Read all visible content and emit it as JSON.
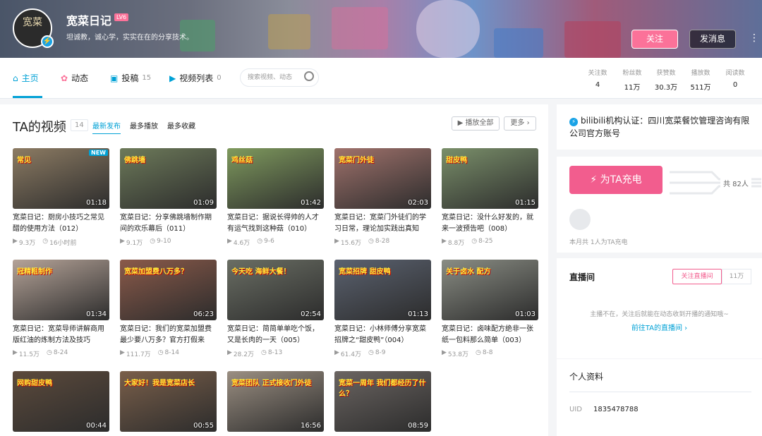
{
  "header": {
    "avatar_text": "宽菜",
    "name": "宽菜日记",
    "level": "LV6",
    "signature": "坦诚教，诚心学，实实在在的分享技术。",
    "follow_label": "关注",
    "message_label": "发消息"
  },
  "nav": {
    "tabs": [
      {
        "label": "主页",
        "count": ""
      },
      {
        "label": "动态",
        "count": ""
      },
      {
        "label": "投稿",
        "count": "15"
      },
      {
        "label": "视频列表",
        "count": "0"
      }
    ],
    "search_placeholder": "搜索视频、动态",
    "stats": [
      {
        "label": "关注数",
        "value": "4"
      },
      {
        "label": "粉丝数",
        "value": "11万"
      },
      {
        "label": "获赞数",
        "value": "30.3万"
      },
      {
        "label": "播放数",
        "value": "511万"
      },
      {
        "label": "阅读数",
        "value": "0"
      }
    ]
  },
  "videos_section": {
    "title": "TA的视频",
    "count": "14",
    "sorts": [
      "最新发布",
      "最多播放",
      "最多收藏"
    ],
    "play_all": "播放全部",
    "more": "更多",
    "items": [
      {
        "caption": "常见",
        "duration": "01:18",
        "title": "宽菜日记：厨房小技巧之常见醋的使用方法（012）",
        "plays": "9.3万",
        "date": "16小时前",
        "new": "NEW",
        "color": "#8c7b63"
      },
      {
        "caption": "佛跳墙",
        "duration": "01:09",
        "title": "宽菜日记：分享佛跳墙制作期间的欢乐幕后（011）",
        "plays": "9.1万",
        "date": "9-10",
        "color": "#6d7a5a"
      },
      {
        "caption": "鸡丝菇",
        "duration": "01:42",
        "title": "宽菜日记：据说长得帅的人才有运气找到这种菇（010）",
        "plays": "4.6万",
        "date": "9-6",
        "color": "#7f9a5e"
      },
      {
        "caption": "宽菜门外徒",
        "duration": "02:03",
        "title": "宽菜日记：宽菜门外徒们的学习日常，理论加实践出真知",
        "plays": "15.6万",
        "date": "8-28",
        "color": "#a0726c"
      },
      {
        "caption": "甜皮鸭",
        "duration": "01:15",
        "title": "宽菜日记：没什么好发的，就来一波预告吧（008）",
        "plays": "8.8万",
        "date": "8-25",
        "color": "#7a8f6a"
      },
      {
        "caption": "冠精粗制作",
        "duration": "01:34",
        "title": "宽菜日记：宽菜导师讲解商用版红油的炼制方法及技巧",
        "plays": "11.5万",
        "date": "8-24",
        "color": "#b5a398"
      },
      {
        "caption": "宽菜加盟费八万多？",
        "duration": "06:23",
        "title": "宽菜日记：我们的宽菜加盟费最少要八万多？官方打假来",
        "plays": "111.7万",
        "date": "8-14",
        "color": "#8b5a4a"
      },
      {
        "caption": "今天吃 海鲜大餐！",
        "duration": "02:54",
        "title": "宽菜日记：简简单单吃个饭，又是长肉的一天（005）",
        "plays": "28.2万",
        "date": "8-13",
        "color": "#6a6e64"
      },
      {
        "caption": "宽菜招牌 甜皮鸭",
        "duration": "01:13",
        "title": "宽菜日记：小林师傅分享宽菜招牌之“甜皮鸭”（004）",
        "plays": "61.4万",
        "date": "8-9",
        "color": "#5b6270"
      },
      {
        "caption": "关于卤水 配方",
        "duration": "01:03",
        "title": "宽菜日记：卤味配方绝非一张纸一包料那么简单（003）",
        "plays": "53.8万",
        "date": "8-8",
        "color": "#8a8d84"
      },
      {
        "caption": "网购甜皮鸭",
        "duration": "00:44",
        "title": "",
        "plays": "",
        "date": "",
        "color": "#5c4a3c"
      },
      {
        "caption": "大家好！我是宽菜店长",
        "duration": "00:55",
        "title": "",
        "plays": "",
        "date": "",
        "color": "#7a5f4a"
      },
      {
        "caption": "宽菜团队 正式接收门外徒",
        "duration": "16:56",
        "title": "",
        "plays": "",
        "date": "",
        "color": "#9b8f82"
      },
      {
        "caption": "宽菜一周年 我们都经历了什么？",
        "duration": "08:59",
        "title": "",
        "plays": "",
        "date": "",
        "color": "#6b6562"
      }
    ]
  },
  "sidebar": {
    "cert_prefix": "bilibili机构认证：",
    "cert_text": "四川宽菜餐饮管理咨询有限公司官方账号",
    "charge_label": "为TA充电",
    "charge_total": "共 82人",
    "charge_sub": "本月共 1人为TA充电",
    "live_title": "直播间",
    "live_follow": "关注直播间",
    "live_count": "11万",
    "live_msg": "主播不在，关注后就能在动态收到开播的通知哦~",
    "live_link": "前往TA的直播间 ›",
    "profile_title": "个人资料",
    "uid_label": "UID",
    "uid_value": "1835478788"
  },
  "colors": {
    "accent": "#00a1d6",
    "pink": "#fb7299"
  }
}
